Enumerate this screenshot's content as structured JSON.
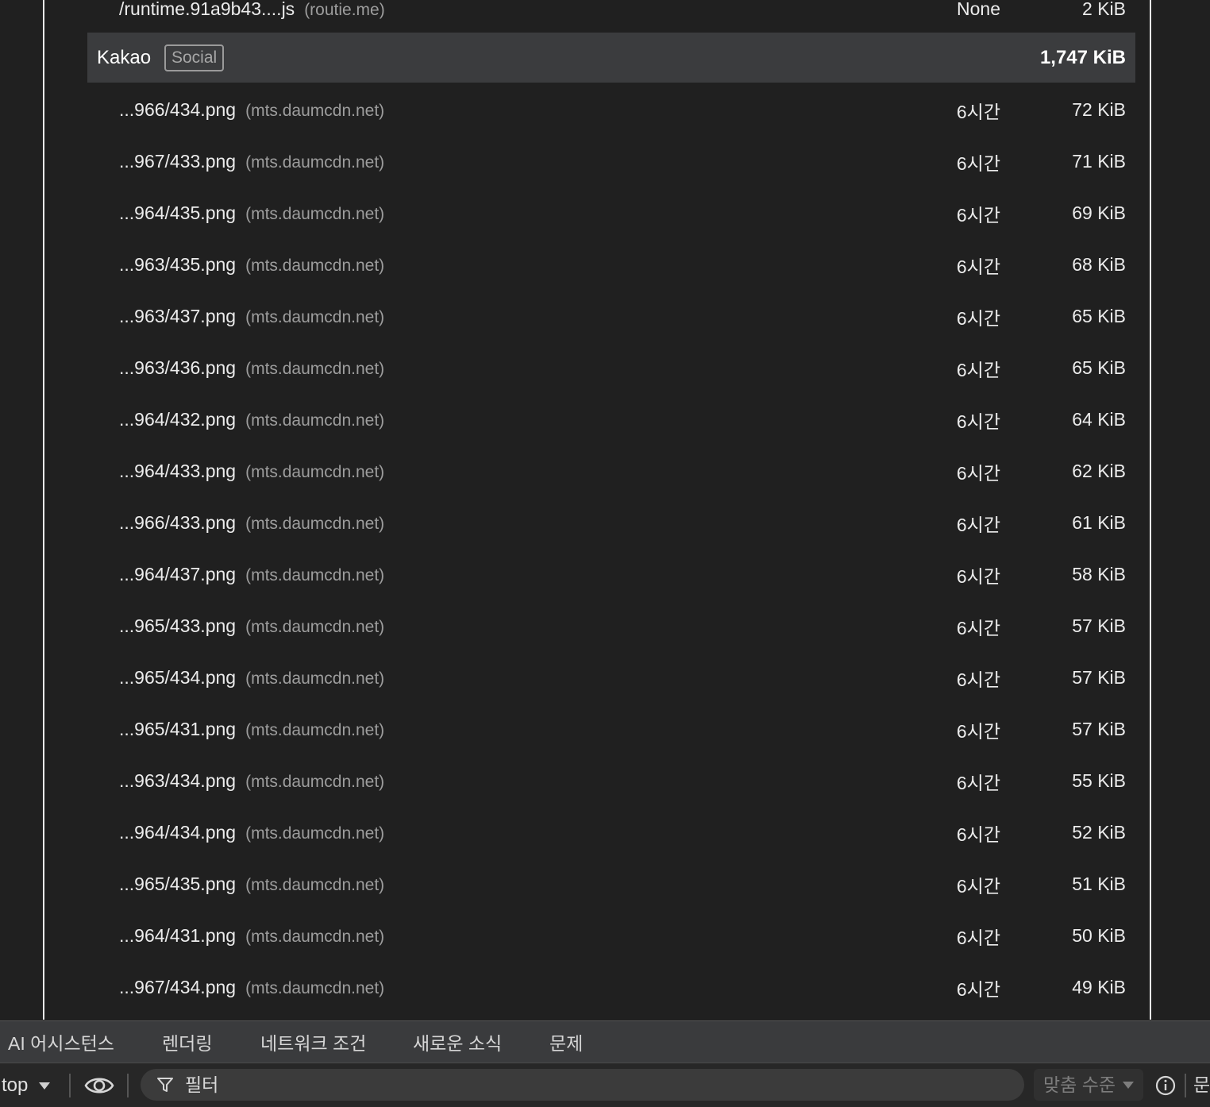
{
  "report": {
    "top_row": {
      "name": "/runtime.91a9b43....js",
      "domain": "(routie.me)",
      "ttl": "None",
      "size": "2 KiB"
    },
    "group": {
      "entity": "Kakao",
      "badge": "Social",
      "total": "1,747 KiB"
    },
    "rows": [
      {
        "name": "...966/434.png",
        "domain": "(mts.daumcdn.net)",
        "ttl": "6시간",
        "size": "72 KiB"
      },
      {
        "name": "...967/433.png",
        "domain": "(mts.daumcdn.net)",
        "ttl": "6시간",
        "size": "71 KiB"
      },
      {
        "name": "...964/435.png",
        "domain": "(mts.daumcdn.net)",
        "ttl": "6시간",
        "size": "69 KiB"
      },
      {
        "name": "...963/435.png",
        "domain": "(mts.daumcdn.net)",
        "ttl": "6시간",
        "size": "68 KiB"
      },
      {
        "name": "...963/437.png",
        "domain": "(mts.daumcdn.net)",
        "ttl": "6시간",
        "size": "65 KiB"
      },
      {
        "name": "...963/436.png",
        "domain": "(mts.daumcdn.net)",
        "ttl": "6시간",
        "size": "65 KiB"
      },
      {
        "name": "...964/432.png",
        "domain": "(mts.daumcdn.net)",
        "ttl": "6시간",
        "size": "64 KiB"
      },
      {
        "name": "...964/433.png",
        "domain": "(mts.daumcdn.net)",
        "ttl": "6시간",
        "size": "62 KiB"
      },
      {
        "name": "...966/433.png",
        "domain": "(mts.daumcdn.net)",
        "ttl": "6시간",
        "size": "61 KiB"
      },
      {
        "name": "...964/437.png",
        "domain": "(mts.daumcdn.net)",
        "ttl": "6시간",
        "size": "58 KiB"
      },
      {
        "name": "...965/433.png",
        "domain": "(mts.daumcdn.net)",
        "ttl": "6시간",
        "size": "57 KiB"
      },
      {
        "name": "...965/434.png",
        "domain": "(mts.daumcdn.net)",
        "ttl": "6시간",
        "size": "57 KiB"
      },
      {
        "name": "...965/431.png",
        "domain": "(mts.daumcdn.net)",
        "ttl": "6시간",
        "size": "57 KiB"
      },
      {
        "name": "...963/434.png",
        "domain": "(mts.daumcdn.net)",
        "ttl": "6시간",
        "size": "55 KiB"
      },
      {
        "name": "...964/434.png",
        "domain": "(mts.daumcdn.net)",
        "ttl": "6시간",
        "size": "52 KiB"
      },
      {
        "name": "...965/435.png",
        "domain": "(mts.daumcdn.net)",
        "ttl": "6시간",
        "size": "51 KiB"
      },
      {
        "name": "...964/431.png",
        "domain": "(mts.daumcdn.net)",
        "ttl": "6시간",
        "size": "50 KiB"
      },
      {
        "name": "...967/434.png",
        "domain": "(mts.daumcdn.net)",
        "ttl": "6시간",
        "size": "49 KiB"
      }
    ]
  },
  "drawer": {
    "tabs": [
      {
        "label": "AI 어시스턴스"
      },
      {
        "label": "렌더링"
      },
      {
        "label": "네트워크 조건"
      },
      {
        "label": "새로운 소식"
      },
      {
        "label": "문제"
      }
    ]
  },
  "console": {
    "context": "top",
    "filter_placeholder": "필터",
    "level": "맞춤 수준",
    "issues_cut": "문"
  },
  "colors": {
    "background": "#202020",
    "group_row": "#3b3c3e",
    "tab_bar": "#3a3b3d",
    "border": "#e8e8e8",
    "muted_text": "#9d9d9d"
  },
  "icons": [
    "eye-icon",
    "filter-icon",
    "chevron-down-icon",
    "info-icon"
  ]
}
